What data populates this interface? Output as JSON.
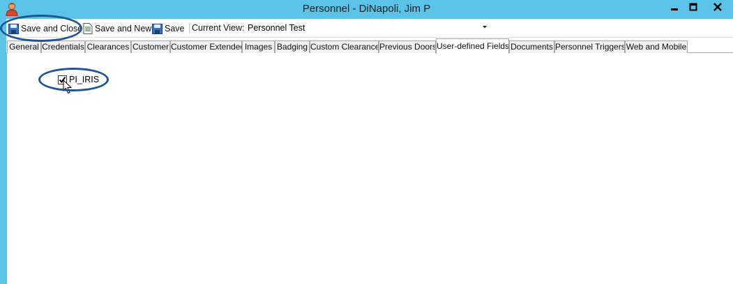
{
  "window": {
    "title": "Personnel  -  DiNapoli, Jim P",
    "app_icon": "person-icon",
    "controls": [
      "minimize-icon",
      "maximize-icon",
      "close-icon"
    ]
  },
  "toolbar": {
    "save_and_close": "Save and Close",
    "save_and_new": "Save and New",
    "save": "Save",
    "current_view_label": "Current View:",
    "current_view_value": "Personnel Test"
  },
  "tabs": [
    {
      "label": "General"
    },
    {
      "label": "Credentials"
    },
    {
      "label": "Clearances"
    },
    {
      "label": "Customer"
    },
    {
      "label": "Customer Extended"
    },
    {
      "label": "Images"
    },
    {
      "label": "Badging"
    },
    {
      "label": "Custom Clearance"
    },
    {
      "label": "Previous Doors"
    },
    {
      "label": "User-defined Fields",
      "active": true
    },
    {
      "label": "Documents"
    },
    {
      "label": "Personnel Triggers"
    },
    {
      "label": "Web and Mobile"
    }
  ],
  "fields": {
    "pi_iris_label": "PI_IRIS",
    "pi_iris_checked": true
  },
  "colors": {
    "titlebar": "#5bc3e8",
    "callout": "#1f5596"
  }
}
